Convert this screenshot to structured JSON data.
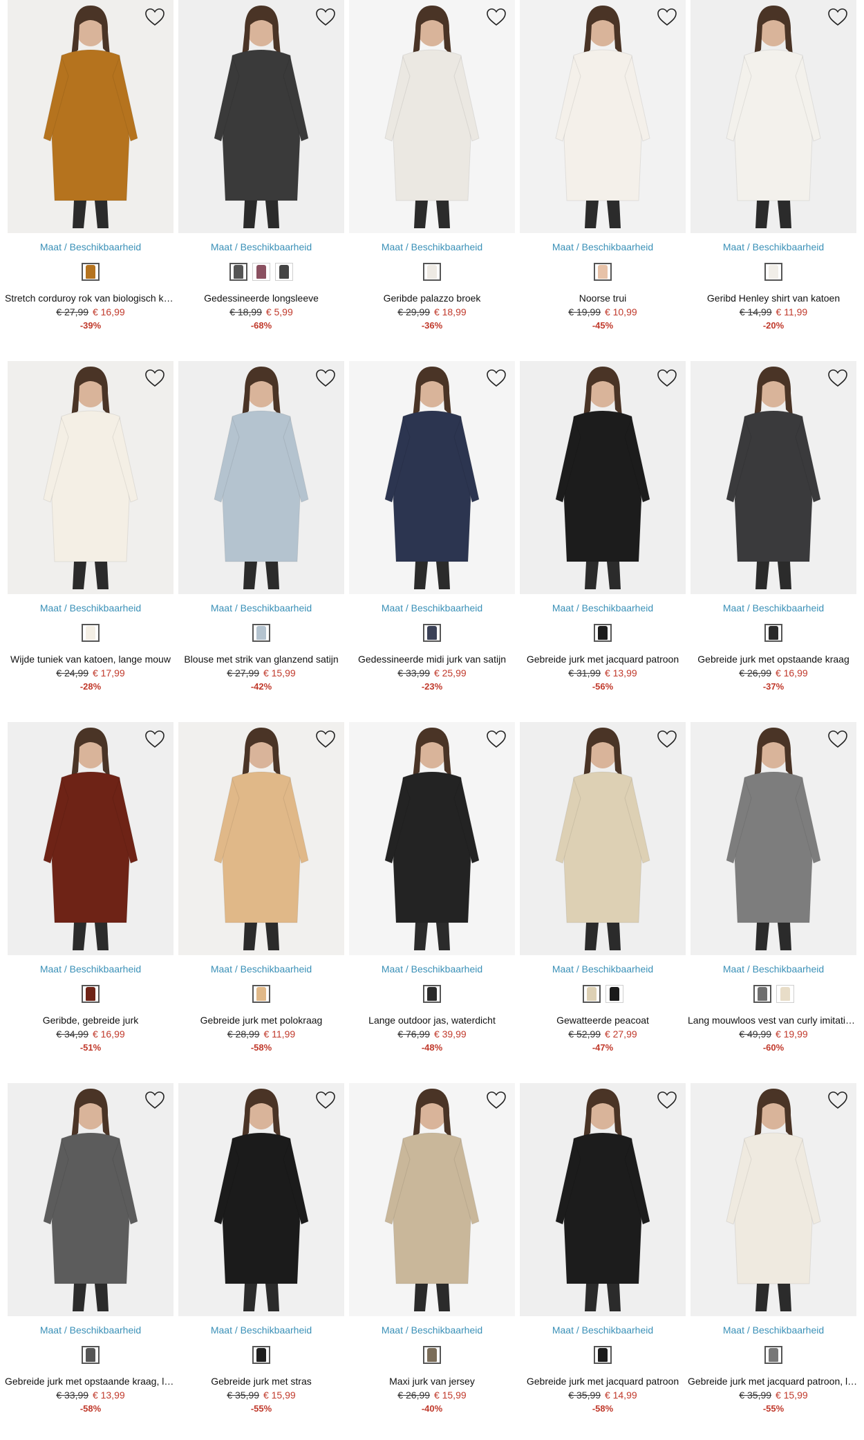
{
  "size_label": "Maat / Beschikbaarheid",
  "products": [
    {
      "name": "Stretch corduroy rok van biologisch katoen",
      "old_price": "€ 27,99",
      "new_price": "€ 16,99",
      "discount": "-39%",
      "swatches": [
        "#b5731e"
      ],
      "bg": "#f0efed",
      "color": "#b5731e"
    },
    {
      "name": "Gedessineerde longsleeve",
      "old_price": "€ 18,99",
      "new_price": "€ 5,99",
      "discount": "-68%",
      "swatches": [
        "#555555",
        "#8a5060",
        "#444444"
      ],
      "bg": "#efefef",
      "color": "#3a3a3a"
    },
    {
      "name": "Geribde palazzo broek",
      "old_price": "€ 29,99",
      "new_price": "€ 18,99",
      "discount": "-36%",
      "swatches": [
        "#eeeae4"
      ],
      "bg": "#f5f5f5",
      "color": "#ebe8e2"
    },
    {
      "name": "Noorse trui",
      "old_price": "€ 19,99",
      "new_price": "€ 10,99",
      "discount": "-45%",
      "swatches": [
        "#e7c2a8"
      ],
      "bg": "#f2f2f2",
      "color": "#f4f0ea"
    },
    {
      "name": "Geribd Henley shirt van katoen",
      "old_price": "€ 14,99",
      "new_price": "€ 11,99",
      "discount": "-20%",
      "swatches": [
        "#f1eee8"
      ],
      "bg": "#efefef",
      "color": "#f3f1ec"
    },
    {
      "name": "Wijde tuniek van katoen, lange mouw",
      "old_price": "€ 24,99",
      "new_price": "€ 17,99",
      "discount": "-28%",
      "swatches": [
        "#f4efe5"
      ],
      "bg": "#f0efed",
      "color": "#f4efe5"
    },
    {
      "name": "Blouse met strik van glanzend satijn",
      "old_price": "€ 27,99",
      "new_price": "€ 15,99",
      "discount": "-42%",
      "swatches": [
        "#b4c3cf"
      ],
      "bg": "#efefef",
      "color": "#b4c3cf"
    },
    {
      "name": "Gedessineerde midi jurk van satijn",
      "old_price": "€ 33,99",
      "new_price": "€ 25,99",
      "discount": "-23%",
      "swatches": [
        "#3b4157"
      ],
      "bg": "#f5f5f5",
      "color": "#2c3550"
    },
    {
      "name": "Gebreide jurk met jacquard patroon",
      "old_price": "€ 31,99",
      "new_price": "€ 13,99",
      "discount": "-56%",
      "swatches": [
        "#1c1c1c"
      ],
      "bg": "#efefef",
      "color": "#1c1c1c"
    },
    {
      "name": "Gebreide jurk met opstaande kraag",
      "old_price": "€ 26,99",
      "new_price": "€ 16,99",
      "discount": "-37%",
      "swatches": [
        "#2a2a2a"
      ],
      "bg": "#f0f0f0",
      "color": "#3a3a3c"
    },
    {
      "name": "Geribde, gebreide jurk",
      "old_price": "€ 34,99",
      "new_price": "€ 16,99",
      "discount": "-51%",
      "swatches": [
        "#6e2316"
      ],
      "bg": "#efefef",
      "color": "#6e2316"
    },
    {
      "name": "Gebreide jurk met polokraag",
      "old_price": "€ 28,99",
      "new_price": "€ 11,99",
      "discount": "-58%",
      "swatches": [
        "#e0b888"
      ],
      "bg": "#f1f0ee",
      "color": "#e0b888"
    },
    {
      "name": "Lange outdoor jas, waterdicht",
      "old_price": "€ 76,99",
      "new_price": "€ 39,99",
      "discount": "-48%",
      "swatches": [
        "#2a2a2a"
      ],
      "bg": "#f5f5f5",
      "color": "#232323"
    },
    {
      "name": "Gewatteerde peacoat",
      "old_price": "€ 52,99",
      "new_price": "€ 27,99",
      "discount": "-47%",
      "swatches": [
        "#ddd0b4",
        "#1a1a1a"
      ],
      "bg": "#efefef",
      "color": "#ddd0b4"
    },
    {
      "name": "Lang mouwloos vest van curly imitatiebont",
      "old_price": "€ 49,99",
      "new_price": "€ 19,99",
      "discount": "-60%",
      "swatches": [
        "#6f6f6f",
        "#e8ddc8"
      ],
      "bg": "#f0f0f0",
      "color": "#7d7d7d"
    },
    {
      "name": "Gebreide jurk met opstaande kraag, lange mouw",
      "old_price": "€ 33,99",
      "new_price": "€ 13,99",
      "discount": "-58%",
      "swatches": [
        "#555555"
      ],
      "bg": "#efefef",
      "color": "#5c5c5c"
    },
    {
      "name": "Gebreide jurk met stras",
      "old_price": "€ 35,99",
      "new_price": "€ 15,99",
      "discount": "-55%",
      "swatches": [
        "#1e1e1e"
      ],
      "bg": "#f0f0f0",
      "color": "#1b1b1b"
    },
    {
      "name": "Maxi jurk van jersey",
      "old_price": "€ 26,99",
      "new_price": "€ 15,99",
      "discount": "-40%",
      "swatches": [
        "#7a6c58"
      ],
      "bg": "#f5f5f5",
      "color": "#c9b79a"
    },
    {
      "name": "Gebreide jurk met jacquard patroon",
      "old_price": "€ 35,99",
      "new_price": "€ 14,99",
      "discount": "-58%",
      "swatches": [
        "#1c1c1c"
      ],
      "bg": "#efefef",
      "color": "#1c1c1c"
    },
    {
      "name": "Gebreide jurk met jacquard patroon, lange mouw",
      "old_price": "€ 35,99",
      "new_price": "€ 15,99",
      "discount": "-55%",
      "swatches": [
        "#777777"
      ],
      "bg": "#f0f0f0",
      "color": "#efeae0"
    }
  ]
}
